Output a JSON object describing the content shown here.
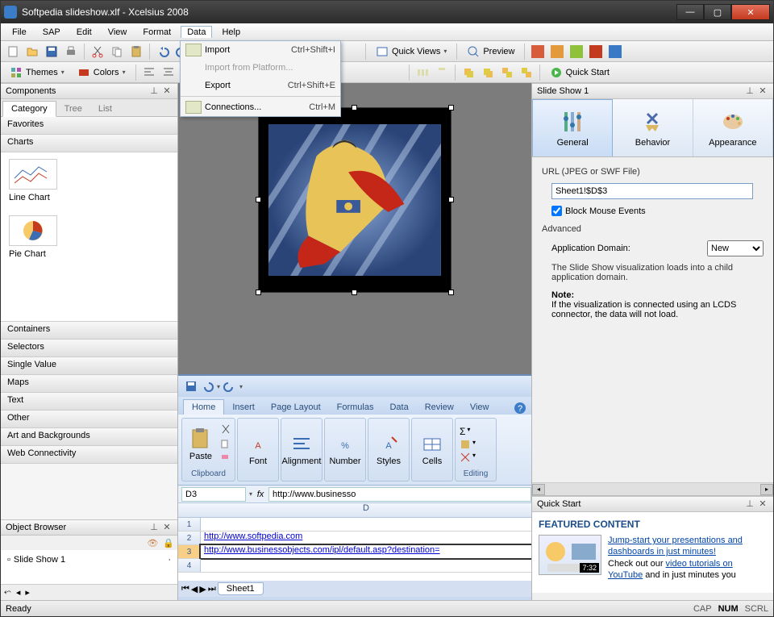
{
  "title": "Softpedia slideshow.xlf - Xcelsius 2008",
  "menus": [
    "File",
    "SAP",
    "Edit",
    "View",
    "Format",
    "Data",
    "Help"
  ],
  "active_menu": "Data",
  "dropdown": [
    {
      "label": "Import",
      "shortcut": "Ctrl+Shift+I",
      "icon": true
    },
    {
      "label": "Import from Platform...",
      "disabled": true
    },
    {
      "label": "Export",
      "shortcut": "Ctrl+Shift+E"
    },
    {
      "sep": true
    },
    {
      "label": "Connections...",
      "shortcut": "Ctrl+M",
      "icon": true
    }
  ],
  "toolbar1": {
    "quick_views": "Quick Views",
    "preview": "Preview"
  },
  "toolbar2": {
    "themes": "Themes",
    "colors": "Colors",
    "quick_start": "Quick Start"
  },
  "components_panel": {
    "title": "Components",
    "tabs": [
      "Category",
      "Tree",
      "List"
    ],
    "active_tab": "Category",
    "categories_top": [
      "Favorites",
      "Charts"
    ],
    "chart_items": [
      "Line Chart",
      "Pie Chart"
    ],
    "categories": [
      "Containers",
      "Selectors",
      "Single Value",
      "Maps",
      "Text",
      "Other",
      "Art and Backgrounds",
      "Web Connectivity"
    ]
  },
  "object_browser": {
    "title": "Object Browser",
    "items": [
      "Slide Show 1"
    ]
  },
  "excel": {
    "tabs": [
      "Home",
      "Insert",
      "Page Layout",
      "Formulas",
      "Data",
      "Review",
      "View"
    ],
    "active_tab": "Home",
    "groups": {
      "clipboard": "Clipboard",
      "paste": "Paste",
      "font": "Font",
      "alignment": "Alignment",
      "number": "Number",
      "styles": "Styles",
      "cells": "Cells",
      "editing": "Editing"
    },
    "namebox": "D3",
    "formula": "http://www.businesso",
    "col": "D",
    "rows": [
      {
        "n": "1",
        "v": ""
      },
      {
        "n": "2",
        "v": "http://www.softpedia.com"
      },
      {
        "n": "3",
        "v": "http://www.businessobjects.com/ipl/default.asp?destination=",
        "sel": true
      },
      {
        "n": "4",
        "v": ""
      }
    ],
    "sheet": "Sheet1"
  },
  "properties": {
    "title": "Slide Show 1",
    "tabs": [
      {
        "label": "General",
        "active": true
      },
      {
        "label": "Behavior"
      },
      {
        "label": "Appearance"
      }
    ],
    "url_label": "URL (JPEG or SWF File)",
    "url_value": "Sheet1!$D$3",
    "block_mouse": "Block Mouse Events",
    "block_mouse_checked": true,
    "advanced": "Advanced",
    "app_domain_label": "Application Domain:",
    "app_domain_value": "New",
    "desc1": "The Slide Show visualization loads into a child application domain.",
    "note_label": "Note:",
    "note_body": "If the visualization is connected using an LCDS connector, the data will not load."
  },
  "quickstart": {
    "title": "Quick Start",
    "featured": "FEATURED CONTENT",
    "link1": "Jump-start your presentations and dashboards in just minutes!",
    "body1": "Check out our ",
    "link2": "video tutorials on YouTube",
    "body2": " and in just minutes you",
    "duration": "7:32"
  },
  "status": {
    "left": "Ready",
    "indicators": [
      "CAP",
      "NUM",
      "SCRL"
    ]
  }
}
